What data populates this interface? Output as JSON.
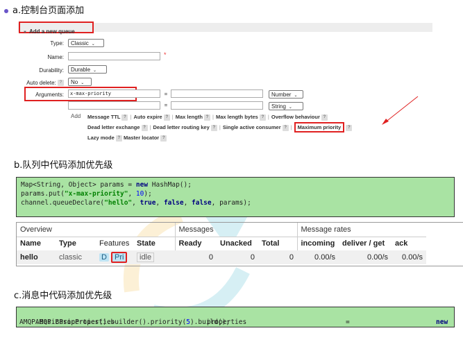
{
  "section_a": {
    "title": "a.控制台页面添加"
  },
  "form": {
    "legend": "Add a new queue",
    "type_label": "Type:",
    "type_value": "Classic",
    "name_label": "Name:",
    "name_required": "*",
    "durability_label": "Durability:",
    "durability_value": "Durable",
    "autodelete_label": "Auto delete:",
    "autodelete_value": "No",
    "help": "?",
    "arguments_label": "Arguments:",
    "arg1_key": "x-max-priority",
    "equals": "=",
    "arg1_type": "Number",
    "arg2_type": "String",
    "add_label": "Add",
    "add_row1": [
      "Message TTL",
      "Auto expire",
      "Max length",
      "Max length bytes",
      "Overflow behaviour"
    ],
    "add_row2": [
      "Dead letter exchange",
      "Dead letter routing key",
      "Single active consumer",
      "Maximum priority"
    ],
    "add_row3": [
      "Lazy mode",
      "Master locator"
    ]
  },
  "section_b": {
    "title": "b.队列中代码添加优先级"
  },
  "code_b": {
    "l1_a": "Map<String, Object> params = ",
    "l1_kw": "new",
    "l1_b": " HashMap();",
    "l2_a": "params.put(",
    "l2_str": "\"x-max-priority\"",
    "l2_b": ", ",
    "l2_num": "10",
    "l2_c": ");",
    "l3_a": "channel.queueDeclare(",
    "l3_str": "\"hello\"",
    "l3_b": ", ",
    "l3_kw1": "true",
    "l3_c": ", ",
    "l3_kw2": "false",
    "l3_d": ", ",
    "l3_kw3": "false",
    "l3_e": ", params);"
  },
  "table": {
    "group_overview": "Overview",
    "group_messages": "Messages",
    "group_rates": "Message rates",
    "headers": [
      "Name",
      "Type",
      "Features",
      "State",
      "Ready",
      "Unacked",
      "Total",
      "incoming",
      "deliver / get",
      "ack"
    ],
    "row": {
      "name": "hello",
      "type": "classic",
      "feature_d": "D",
      "feature_pri": "Pri",
      "state": "idle",
      "ready": "0",
      "unacked": "0",
      "total": "0",
      "incoming": "0.00/s",
      "deliver": "0.00/s",
      "ack": "0.00/s"
    }
  },
  "section_c": {
    "title": "c.消息中代码添加优先级"
  },
  "code_c": {
    "l1_a": "AMQP.BasicProperties",
    "l1_b": "properties",
    "l1_eq": "=",
    "l1_kw": "new",
    "l2_a": "AMQP.BasicProperties().builder().priority(",
    "l2_num": "5",
    "l2_b": ").build();"
  },
  "colors": {
    "accent_red": "#e02020",
    "code_bg": "#a9e3a3",
    "feature_bg": "#bfe4f4"
  }
}
